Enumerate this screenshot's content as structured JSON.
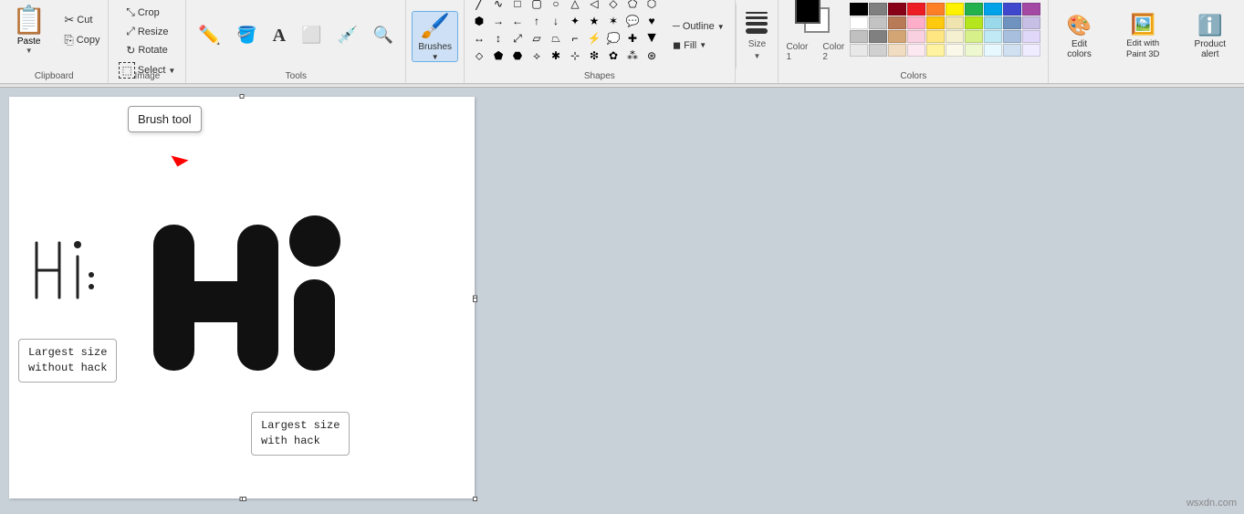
{
  "ribbon": {
    "groups": {
      "clipboard": {
        "label": "Clipboard",
        "paste_label": "Paste",
        "cut_label": "Cut",
        "copy_label": "Copy"
      },
      "image": {
        "label": "Image",
        "crop_label": "Crop",
        "resize_label": "Resize",
        "rotate_label": "Rotate",
        "select_label": "Select"
      },
      "tools": {
        "label": "Tools"
      },
      "brushes": {
        "label": "Brushes",
        "active": true
      },
      "shapes": {
        "label": "Shapes",
        "outline_label": "Outline",
        "fill_label": "Fill"
      },
      "size": {
        "label": "Size"
      },
      "colors": {
        "label": "Colors",
        "color1_label": "Color 1",
        "color2_label": "Color 2",
        "edit_colors_label": "Edit colors",
        "paint3d_label": "Edit with Paint 3D",
        "product_alert_label": "Product alert"
      }
    }
  },
  "tooltip": {
    "brush_tool": "Brush tool"
  },
  "canvas": {
    "labels": {
      "without_hack": "Largest size\nwithout hack",
      "with_hack": "Largest size\nwith hack"
    }
  },
  "watermark": "wsxdn.com",
  "colors": {
    "row1": [
      "#000000",
      "#7f7f7f",
      "#880015",
      "#ed1c24",
      "#ff7f27",
      "#fff200",
      "#22b14c",
      "#00a2e8",
      "#3f48cc",
      "#a349a4"
    ],
    "row2": [
      "#ffffff",
      "#c3c3c3",
      "#b97a57",
      "#ffaec9",
      "#ffc90e",
      "#efe4b0",
      "#b5e61d",
      "#99d9ea",
      "#7092be",
      "#c8bfe7"
    ],
    "row3": [
      "#ffffff",
      "#ffffff",
      "#ffffff",
      "#ffffff",
      "#ffffff",
      "#ffffff",
      "#ffffff",
      "#ffffff",
      "#ffffff",
      "#ffffff"
    ],
    "row4": [
      "#ffffff",
      "#ffffff",
      "#ffffff",
      "#ffffff",
      "#ffffff",
      "#ffffff",
      "#ffffff",
      "#ffffff",
      "#ffffff",
      "#ffffff"
    ]
  }
}
